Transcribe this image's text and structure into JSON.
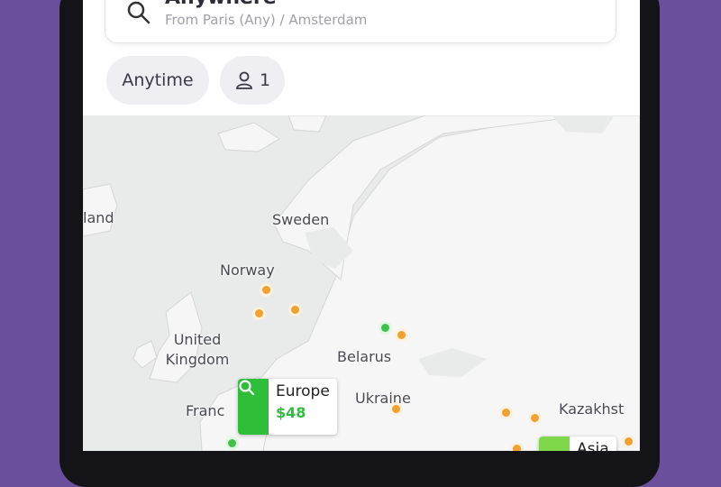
{
  "search": {
    "title": "Anywhere",
    "subtitle": "From Paris (Any) / Amsterdam"
  },
  "chips": {
    "date_label": "Anytime",
    "passengers": "1"
  },
  "map": {
    "labels": {
      "iceland": "land",
      "sweden": "Sweden",
      "norway": "Norway",
      "uk": "United\nKingdom",
      "belarus": "Belarus",
      "ukraine": "Ukraine",
      "france": "Franc",
      "kazakhstan": "Kazakhst"
    }
  },
  "pins": {
    "europe": {
      "name": "Europe",
      "price": "$48"
    },
    "asia": {
      "name": "Asia"
    }
  },
  "colors": {
    "background": "#6a4f9c",
    "accent_green": "#2fbe3a",
    "dot_orange": "#f2a12e",
    "water": "#e9eaea"
  },
  "icons": [
    "search-icon",
    "person-icon"
  ]
}
